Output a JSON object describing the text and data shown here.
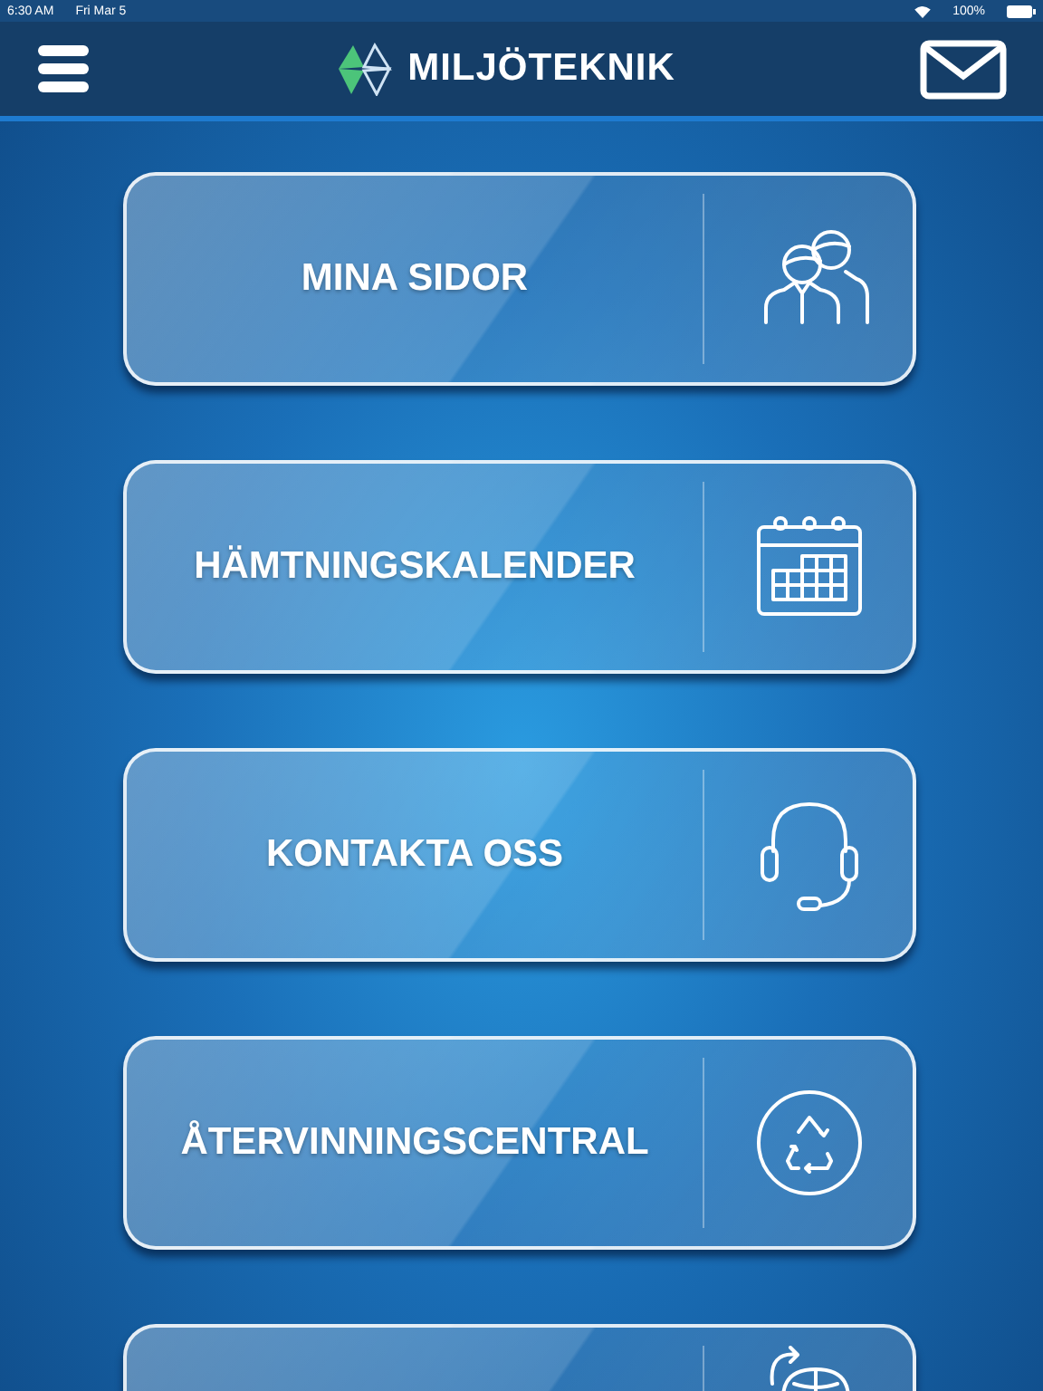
{
  "status_bar": {
    "time": "6:30 AM",
    "date": "Fri Mar 5",
    "battery": "100%"
  },
  "header": {
    "title": "MILJÖTEKNIK"
  },
  "buttons": [
    {
      "label": "MINA SIDOR",
      "kind": "people"
    },
    {
      "label": "HÄMTNINGSKALENDER",
      "kind": "calendar"
    },
    {
      "label": "KONTAKTA OSS",
      "kind": "headset"
    },
    {
      "label": "ÅTERVINNINGSCENTRAL",
      "kind": "recycle"
    },
    {
      "kind": "globe"
    }
  ]
}
